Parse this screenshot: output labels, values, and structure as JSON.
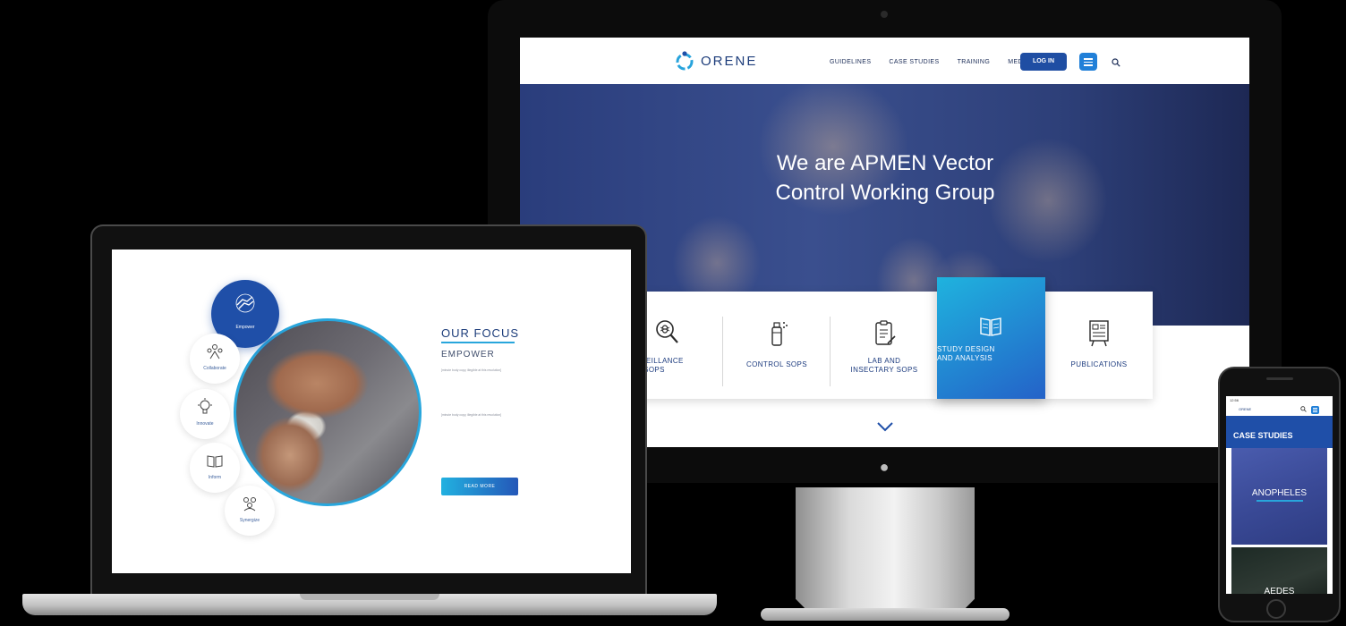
{
  "imac": {
    "brand": "ORENE",
    "nav": [
      "GUIDELINES",
      "CASE STUDIES",
      "TRAINING",
      "MEDIA"
    ],
    "login_label": "LOG IN",
    "hero_title_line1": "We are APMEN Vector",
    "hero_title_line2": "Control Working Group",
    "services": [
      {
        "line1": "SURVEILLANCE",
        "line2": "SOPS",
        "icon": "magnifier-bug-icon"
      },
      {
        "line1": "CONTROL SOPS",
        "line2": "",
        "icon": "spray-can-icon"
      },
      {
        "line1": "LAB AND",
        "line2": "INSECTARY SOPS",
        "icon": "clipboard-icon"
      },
      {
        "line1": "STUDY DESIGN",
        "line2": "AND ANALYSIS",
        "icon": "open-book-icon"
      },
      {
        "line1": "PUBLICATIONS",
        "line2": "",
        "icon": "publication-board-icon"
      }
    ]
  },
  "macbook": {
    "focus_title": "OUR FOCUS",
    "focus_subtitle": "EMPOWER",
    "focus_nodes": [
      "Empower",
      "Collaborate",
      "Innovate",
      "Inform",
      "Synergize"
    ],
    "paragraph1": "[minute body copy, illegible at this resolution]",
    "paragraph2": "[minute body copy, illegible at this resolution]",
    "read_more": "READ MORE"
  },
  "iphone": {
    "status_time": "12:56",
    "brand": "ORENE",
    "page_title": "CASE STUDIES",
    "cards": [
      "ANOPHELES",
      "AEDES"
    ]
  },
  "colors": {
    "primary_blue": "#1f4fa8",
    "accent_cyan": "#28a6dc",
    "hero_navy": "#2f4180"
  }
}
